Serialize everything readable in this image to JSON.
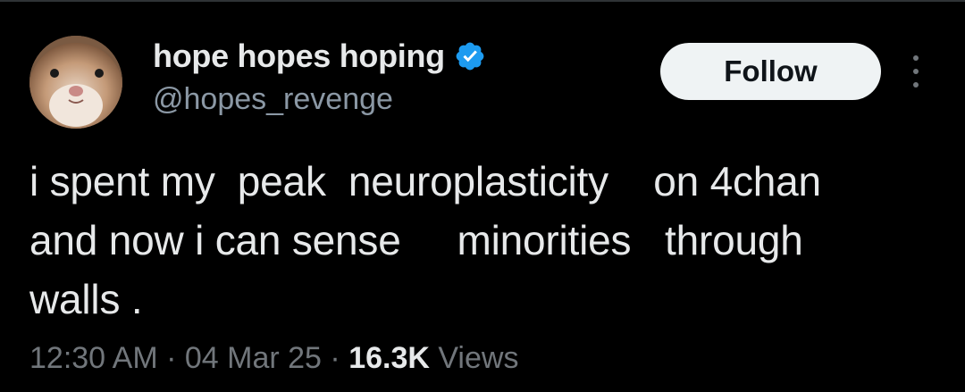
{
  "author": {
    "display_name": "hope hopes hoping",
    "handle": "@hopes_revenge",
    "verified_icon": "verified-badge-icon",
    "avatar_icon": "hamster-avatar"
  },
  "actions": {
    "follow_label": "Follow",
    "more_icon": "more-options-icon"
  },
  "tweet": {
    "lines": [
      "i spent my  peak  neuroplasticity    on 4chan",
      "and now i can sense     minorities   through",
      "walls ."
    ]
  },
  "meta": {
    "time": "12:30 AM",
    "separator1": " · ",
    "date": "04 Mar 25",
    "separator2": " · ",
    "views_count": "16.3K",
    "views_label": " Views"
  },
  "colors": {
    "background": "#000000",
    "primary_text": "#e7e9ea",
    "secondary_text": "#71767b",
    "verified_blue": "#1d9bf0",
    "follow_bg": "#eff3f4"
  }
}
